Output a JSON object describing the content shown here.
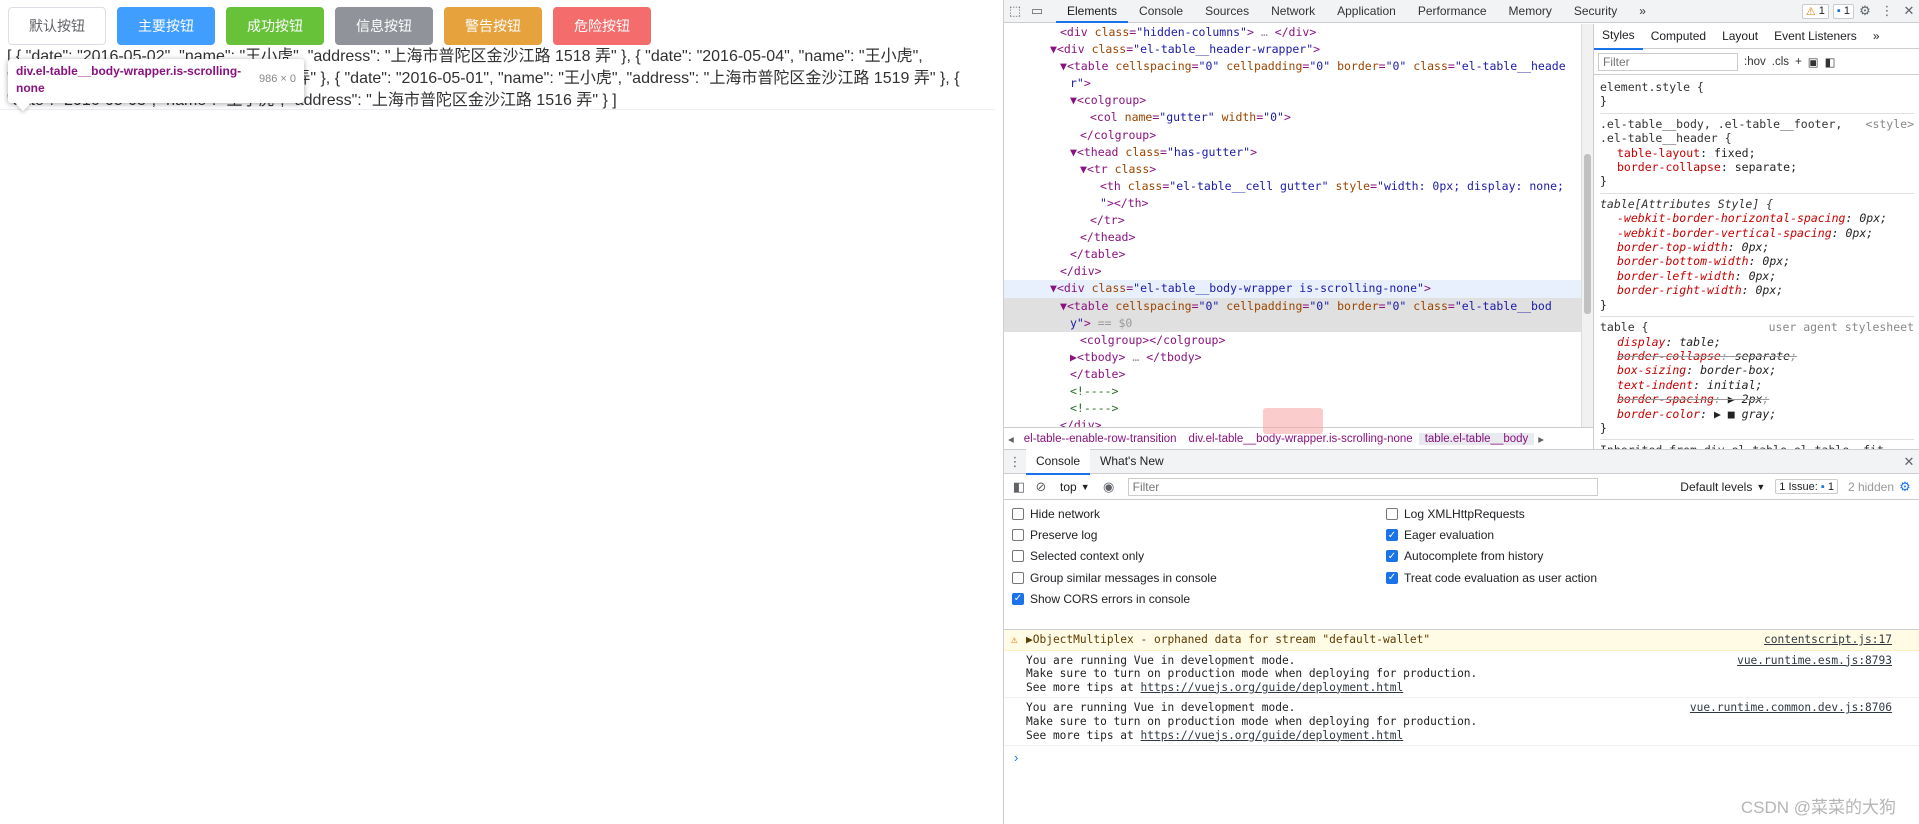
{
  "page": {
    "buttons": [
      {
        "label": "默认按钮",
        "kind": "default"
      },
      {
        "label": "主要按钮",
        "kind": "primary"
      },
      {
        "label": "成功按钮",
        "kind": "success"
      },
      {
        "label": "信息按钮",
        "kind": "info"
      },
      {
        "label": "警告按钮",
        "kind": "warning"
      },
      {
        "label": "危险按钮",
        "kind": "danger"
      }
    ],
    "json_text": "[ { \"date\": \"2016-05-02\", \"name\": \"王小虎\", \"address\": \"上海市普陀区金沙江路 1518 弄\" }, { \"date\": \"2016-05-04\", \"name\": \"王小虎\", \"address\": \"上海市普陀区金沙江路 1517 弄\" }, { \"date\": \"2016-05-01\", \"name\": \"王小虎\", \"address\": \"上海市普陀区金沙江路 1519 弄\" }, { \"date\": \"2016-05-03\", \"name\": \"王小虎\", \"address\": \"上海市普陀区金沙江路 1516 弄\" } ]",
    "tooltip": {
      "selector": "div.el-table__body-wrapper.is-scrolling-none",
      "dims": "986 × 0"
    }
  },
  "devtools": {
    "tabs": [
      "Elements",
      "Console",
      "Sources",
      "Network",
      "Application",
      "Performance",
      "Memory",
      "Security"
    ],
    "more": "»",
    "warnings": "1",
    "messages": "1",
    "elements_lines": [
      {
        "indent": 5,
        "html": "<span class=\"t\">&lt;div</span> <span class=\"a\">class</span>=<span class=\"v\">\"hidden-columns\"</span><span class=\"t\">&gt;</span><span class=\"g\"> … </span><span class=\"t\">&lt;/div&gt;</span>"
      },
      {
        "indent": 4,
        "html": "▼<span class=\"t\">&lt;div</span> <span class=\"a\">class</span>=<span class=\"v\">\"el-table__header-wrapper\"</span><span class=\"t\">&gt;</span>"
      },
      {
        "indent": 5,
        "html": "▼<span class=\"t\">&lt;table</span> <span class=\"a\">cellspacing</span>=<span class=\"v\">\"0\"</span> <span class=\"a\">cellpadding</span>=<span class=\"v\">\"0\"</span> <span class=\"a\">border</span>=<span class=\"v\">\"0\"</span> <span class=\"a\">class</span>=<span class=\"v\">\"el-table__heade</span>"
      },
      {
        "indent": 6,
        "html": "<span class=\"v\">r\"</span><span class=\"t\">&gt;</span>"
      },
      {
        "indent": 6,
        "html": "▼<span class=\"t\">&lt;colgroup&gt;</span>"
      },
      {
        "indent": 8,
        "html": "<span class=\"t\">&lt;col</span> <span class=\"a\">name</span>=<span class=\"v\">\"gutter\"</span> <span class=\"a\">width</span>=<span class=\"v\">\"0\"</span><span class=\"t\">&gt;</span>"
      },
      {
        "indent": 7,
        "html": "<span class=\"t\">&lt;/colgroup&gt;</span>"
      },
      {
        "indent": 6,
        "html": "▼<span class=\"t\">&lt;thead</span> <span class=\"a\">class</span>=<span class=\"v\">\"has-gutter\"</span><span class=\"t\">&gt;</span>"
      },
      {
        "indent": 7,
        "html": "▼<span class=\"t\">&lt;tr</span> <span class=\"a\">class</span><span class=\"t\">&gt;</span>"
      },
      {
        "indent": 9,
        "html": "<span class=\"t\">&lt;th</span> <span class=\"a\">class</span>=<span class=\"v\">\"el-table__cell gutter\"</span> <span class=\"a\">style</span>=<span class=\"v\">\"width: 0px; display: none;</span>"
      },
      {
        "indent": 9,
        "html": "<span class=\"v\">\"</span><span class=\"t\">&gt;&lt;/th&gt;</span>"
      },
      {
        "indent": 8,
        "html": "<span class=\"t\">&lt;/tr&gt;</span>"
      },
      {
        "indent": 7,
        "html": "<span class=\"t\">&lt;/thead&gt;</span>"
      },
      {
        "indent": 6,
        "html": "<span class=\"t\">&lt;/table&gt;</span>"
      },
      {
        "indent": 5,
        "html": "<span class=\"t\">&lt;/div&gt;</span>"
      },
      {
        "indent": 4,
        "hover": true,
        "html": "▼<span class=\"t\">&lt;div</span> <span class=\"a\">class</span>=<span class=\"v\">\"el-table__body-wrapper is-scrolling-none\"</span><span class=\"t\">&gt;</span>"
      },
      {
        "indent": 5,
        "sel": true,
        "html": "▼<span class=\"t\">&lt;table</span> <span class=\"a\">cellspacing</span>=<span class=\"v\">\"0\"</span> <span class=\"a\">cellpadding</span>=<span class=\"v\">\"0\"</span> <span class=\"a\">border</span>=<span class=\"v\">\"0\"</span> <span class=\"a\">class</span>=<span class=\"v\">\"el-table__bod</span>"
      },
      {
        "indent": 6,
        "sel": true,
        "html": "<span class=\"v\">y\"</span><span class=\"t\">&gt;</span><span class=\"g\"> == $0</span>"
      },
      {
        "indent": 7,
        "html": "<span class=\"t\">&lt;colgroup&gt;&lt;/colgroup&gt;</span>"
      },
      {
        "indent": 6,
        "html": "▶<span class=\"t\">&lt;tbody&gt;</span><span class=\"g\"> … </span><span class=\"t\">&lt;/tbody&gt;</span>"
      },
      {
        "indent": 6,
        "html": "<span class=\"t\">&lt;/table&gt;</span>"
      },
      {
        "indent": 6,
        "html": "<span class=\"c\">&lt;!----&gt;</span>"
      },
      {
        "indent": 6,
        "html": "<span class=\"c\">&lt;!----&gt;</span>"
      },
      {
        "indent": 5,
        "html": "<span class=\"t\">&lt;/div&gt;</span>"
      }
    ],
    "breadcrumbs": [
      "el-table--enable-row-transition",
      "div.el-table__body-wrapper.is-scrolling-none",
      "table.el-table__body"
    ],
    "styles_tabs": [
      "Styles",
      "Computed",
      "Layout",
      "Event Listeners"
    ],
    "styles_filter_placeholder": "Filter",
    "styles_hov": ":hov",
    "styles_cls": ".cls",
    "rules": [
      {
        "selector": "element.style {",
        "source": "",
        "decls": []
      },
      {
        "selector": ".el-table__body, .el-table__footer,",
        "selector2": ".el-table__header {",
        "source": "<style>",
        "decls": [
          [
            "table-layout",
            "fixed"
          ],
          [
            "border-collapse",
            "separate"
          ]
        ]
      },
      {
        "selector": "table[Attributes Style] {",
        "italic": true,
        "source": "",
        "decls": [
          [
            "-webkit-border-horizontal-spacing",
            "0px"
          ],
          [
            "-webkit-border-vertical-spacing",
            "0px"
          ],
          [
            "border-top-width",
            "0px"
          ],
          [
            "border-bottom-width",
            "0px"
          ],
          [
            "border-left-width",
            "0px"
          ],
          [
            "border-right-width",
            "0px"
          ]
        ]
      },
      {
        "selector": "table {",
        "source": "user agent stylesheet",
        "italicdecl": true,
        "decls": [
          [
            "display",
            "table"
          ],
          [
            "border-collapse",
            "separate",
            true
          ],
          [
            "box-sizing",
            "border-box"
          ],
          [
            "text-indent",
            "initial"
          ],
          [
            "border-spacing",
            "▶ 2px",
            true
          ],
          [
            "border-color",
            "▶ ■ gray"
          ]
        ]
      },
      {
        "selector": "Inherited from div.el-table.el-table--fit…",
        "source": "",
        "decls": []
      }
    ],
    "drawer_tabs": [
      "Console",
      "What's New"
    ],
    "context": "top",
    "console_filter_placeholder": "Filter",
    "levels": "Default levels",
    "issues": "1 Issue:",
    "issues_count": "1",
    "hidden": "2 hidden",
    "settings_left": [
      {
        "label": "Hide network",
        "checked": false
      },
      {
        "label": "Preserve log",
        "checked": false
      },
      {
        "label": "Selected context only",
        "checked": false
      },
      {
        "label": "Group similar messages in console",
        "checked": false
      },
      {
        "label": "Show CORS errors in console",
        "checked": true
      }
    ],
    "settings_right": [
      {
        "label": "Log XMLHttpRequests",
        "checked": false
      },
      {
        "label": "Eager evaluation",
        "checked": true
      },
      {
        "label": "Autocomplete from history",
        "checked": true
      },
      {
        "label": "Treat code evaluation as user action",
        "checked": true
      }
    ],
    "messages_list": [
      {
        "kind": "warn",
        "text": "▶ObjectMultiplex - orphaned data for stream \"default-wallet\"",
        "source": "contentscript.js:17"
      },
      {
        "kind": "log",
        "text": "You are running Vue in development mode.\nMake sure to turn on production mode when deploying for production.\nSee more tips at ",
        "url": "https://vuejs.org/guide/deployment.html",
        "source": "vue.runtime.esm.js:8793"
      },
      {
        "kind": "log",
        "text": "You are running Vue in development mode.\nMake sure to turn on production mode when deploying for production.\nSee more tips at ",
        "url": "https://vuejs.org/guide/deployment.html",
        "source": "vue.runtime.common.dev.js:8706"
      }
    ],
    "prompt": "›"
  },
  "watermark": "CSDN @菜菜的大狗"
}
